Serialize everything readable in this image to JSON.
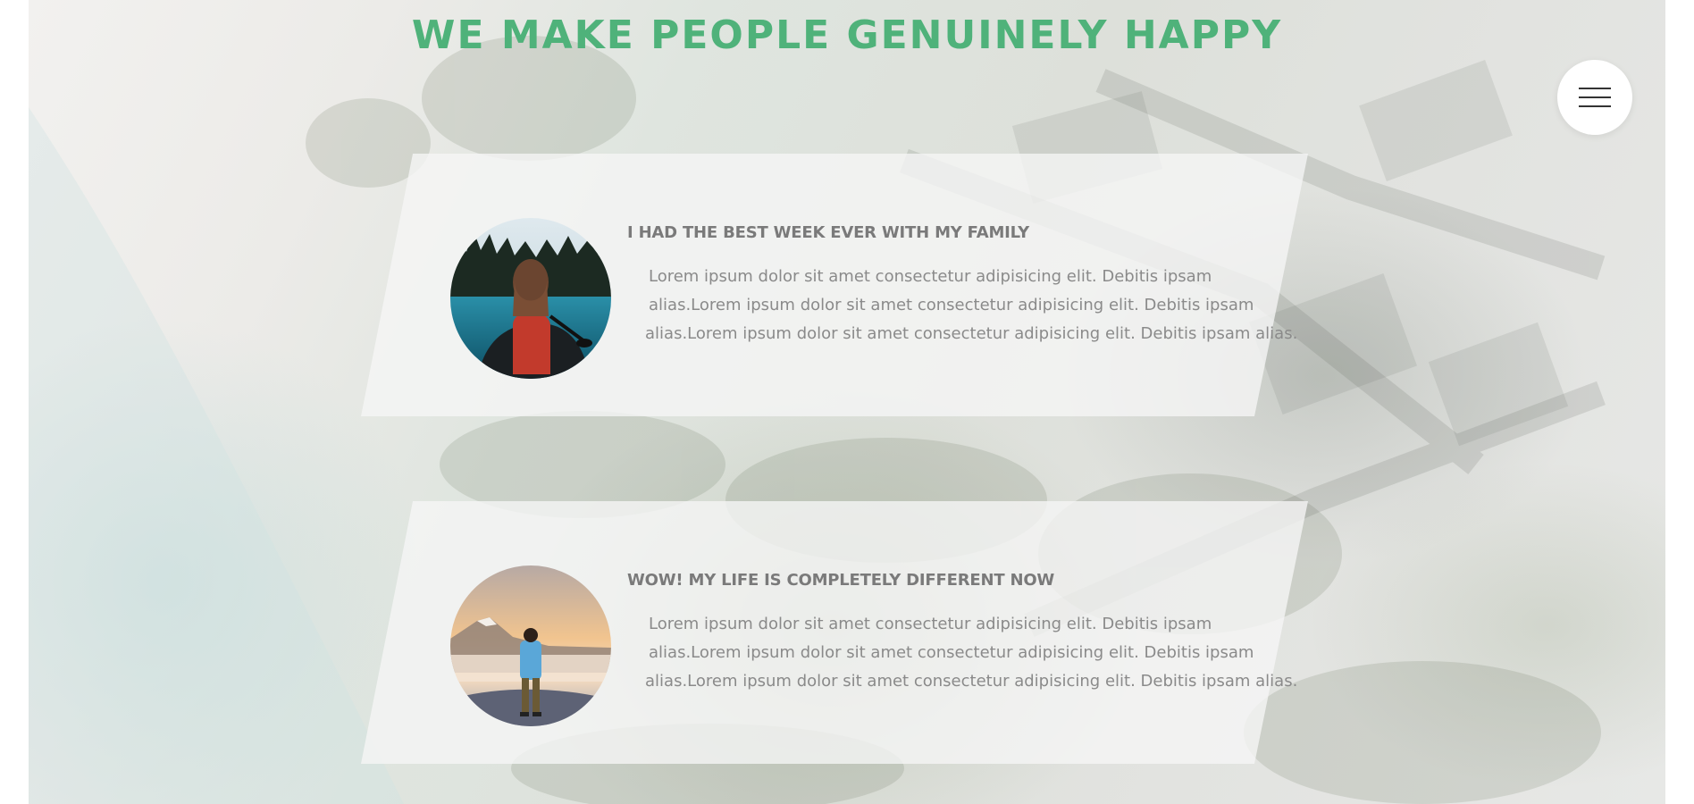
{
  "heading": "WE MAKE PEOPLE GENUINELY HAPPY",
  "menu": {
    "icon": "hamburger-menu-icon"
  },
  "colors": {
    "heading_green": "#4fb27a",
    "card_title": "#7a7a7a",
    "card_text": "#8a8a8a",
    "menu_bg": "#ffffff"
  },
  "testimonials": [
    {
      "title": "I HAD THE BEST WEEK EVER WITH MY FAMILY",
      "lines": [
        "Lorem ipsum dolor sit amet consectetur adipisicing elit. Debitis ipsam",
        "alias.Lorem ipsum dolor sit amet consectetur adipisicing elit. Debitis ipsam",
        "alias.Lorem ipsum dolor sit amet consectetur adipisicing elit. Debitis ipsam alias."
      ],
      "photo": "woman-in-canoe-lake-photo"
    },
    {
      "title": "WOW! MY LIFE IS COMPLETELY DIFFERENT NOW",
      "lines": [
        "Lorem ipsum dolor sit amet consectetur adipisicing elit. Debitis ipsam",
        "alias.Lorem ipsum dolor sit amet consectetur adipisicing elit. Debitis ipsam",
        "alias.Lorem ipsum dolor sit amet consectetur adipisicing elit. Debitis ipsam alias."
      ],
      "photo": "man-on-mountain-sunrise-photo"
    }
  ]
}
